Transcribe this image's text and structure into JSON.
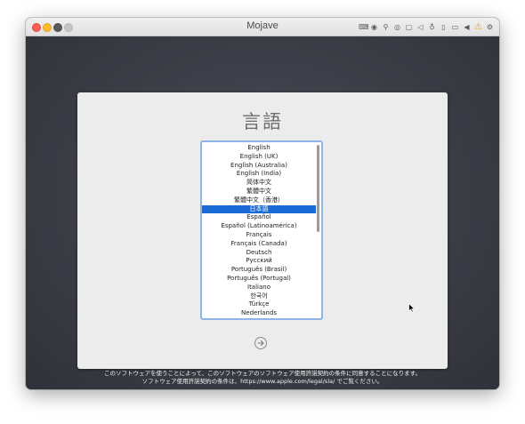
{
  "window": {
    "title": "Mojave",
    "toolbar_icons": [
      "keyboard-icon",
      "record-icon",
      "usb-icon",
      "disc-icon",
      "network-icon",
      "speaker-icon",
      "microphone-icon",
      "tablet-icon",
      "camera-icon",
      "play-left-icon",
      "warning-icon",
      "settings-icon"
    ]
  },
  "installer": {
    "title": "言語",
    "languages": [
      "English",
      "English (UK)",
      "English (Australia)",
      "English (India)",
      "简体中文",
      "繁體中文",
      "繁體中文（香港）",
      "日本語",
      "Español",
      "Español (Latinoamérica)",
      "Français",
      "Français (Canada)",
      "Deutsch",
      "Русский",
      "Português (Brasil)",
      "Português (Portugal)",
      "Italiano",
      "한국어",
      "Türkçe",
      "Nederlands"
    ],
    "selected_language": "日本語",
    "next_icon": "arrow-right-circle-icon",
    "accent_color": "#1a6bd6"
  },
  "footer": {
    "line1": "このソフトウェアを使うことによって、このソフトウェアのソフトウェア使用許諾契約の条件に同意することになります。",
    "line2": "ソフトウェア使用許諾契約の条件は、https://www.apple.com/legal/sla/ でご覧ください。"
  }
}
